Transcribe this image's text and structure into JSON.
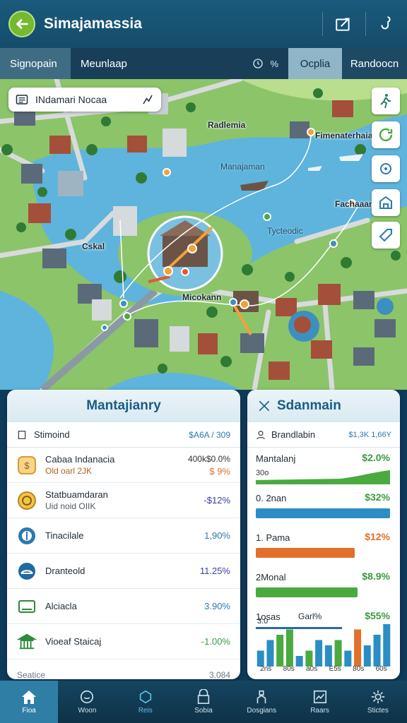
{
  "header": {
    "title": "Simajamassia"
  },
  "tabs": {
    "t1": "Signopain",
    "t2": "Meunlaap",
    "info": " %",
    "t3": "Ocplia",
    "t4": "Randoocn"
  },
  "map": {
    "search_label": "INdamari Nocaa",
    "labels": [
      "Radlemia",
      "Fimenaterhaia",
      "Manajaman",
      "Tycteodic",
      "Cskal",
      "Micokann",
      "Fachaaans"
    ]
  },
  "left_panel": {
    "title": "Mantajianry",
    "head_label": "Stimoind",
    "head_value": "$A6A / 309",
    "rows": [
      {
        "name": "Cabaa Indanacia",
        "sub": "Old oarl 2JK",
        "v1": "400k$0.0%",
        "v2": "$ 9%"
      },
      {
        "name": "Statbuamdaran",
        "sub": "Uid noid OIIK",
        "v1": "",
        "v2": "-$12%"
      },
      {
        "name": "Tinacilale",
        "sub": "",
        "v1": "",
        "v2": "1,90%"
      },
      {
        "name": "Dranteold",
        "sub": "",
        "v1": "",
        "v2": "11.25%"
      },
      {
        "name": "Alciacla",
        "sub": "",
        "v1": "",
        "v2": "3.90%"
      },
      {
        "name": "Vioeaf Staicaj",
        "sub": "",
        "v1": "",
        "v2": "-1.00%"
      }
    ],
    "footer_label": "Seatice",
    "footer_value": "3.084"
  },
  "right_panel": {
    "title": "Sdanmain",
    "head_label": "Brandlabin",
    "head_value": "$1,3K 1,66Y",
    "rows": [
      {
        "label": "Mantalanj",
        "value": "$2.0%",
        "sub": "30o",
        "color": "#4aaa3f"
      },
      {
        "label": "0. 2nan",
        "value": "$32%",
        "sub": "",
        "color": "#4aaa3f"
      },
      {
        "label": "1. Pama",
        "value": "$12%",
        "sub": "",
        "color": "#e2702a"
      },
      {
        "label": "2Monal",
        "value": "$8.9%",
        "sub": "",
        "color": "#4aaa3f"
      },
      {
        "label": "1osas",
        "value": "$55%",
        "sub": "Garl%",
        "color": "#4aaa3f"
      }
    ],
    "chart_label": "3.0",
    "chart_ticks": [
      "2ns",
      "80s",
      "a0s",
      "E5s",
      "80s",
      "60s"
    ],
    "chart_values": [
      3,
      5,
      6,
      7,
      2,
      3,
      5,
      4,
      5,
      3,
      7,
      4,
      6,
      8
    ]
  },
  "bottom_nav": [
    {
      "label": "Fioa",
      "icon": "home-icon"
    },
    {
      "label": "Woon",
      "icon": "circle-icon"
    },
    {
      "label": "Reis",
      "icon": "pin-icon"
    },
    {
      "label": "Sobia",
      "icon": "lock-icon"
    },
    {
      "label": "Dosgians",
      "icon": "person-icon"
    },
    {
      "label": "Raars",
      "icon": "chart-icon"
    },
    {
      "label": "Stictes",
      "icon": "gear-icon"
    }
  ],
  "colors": {
    "accent": "#74b92f",
    "header": "#1a5a7c",
    "water": "#5eb4dc",
    "land": "#8cc46a",
    "blue": "#1b5c85"
  }
}
